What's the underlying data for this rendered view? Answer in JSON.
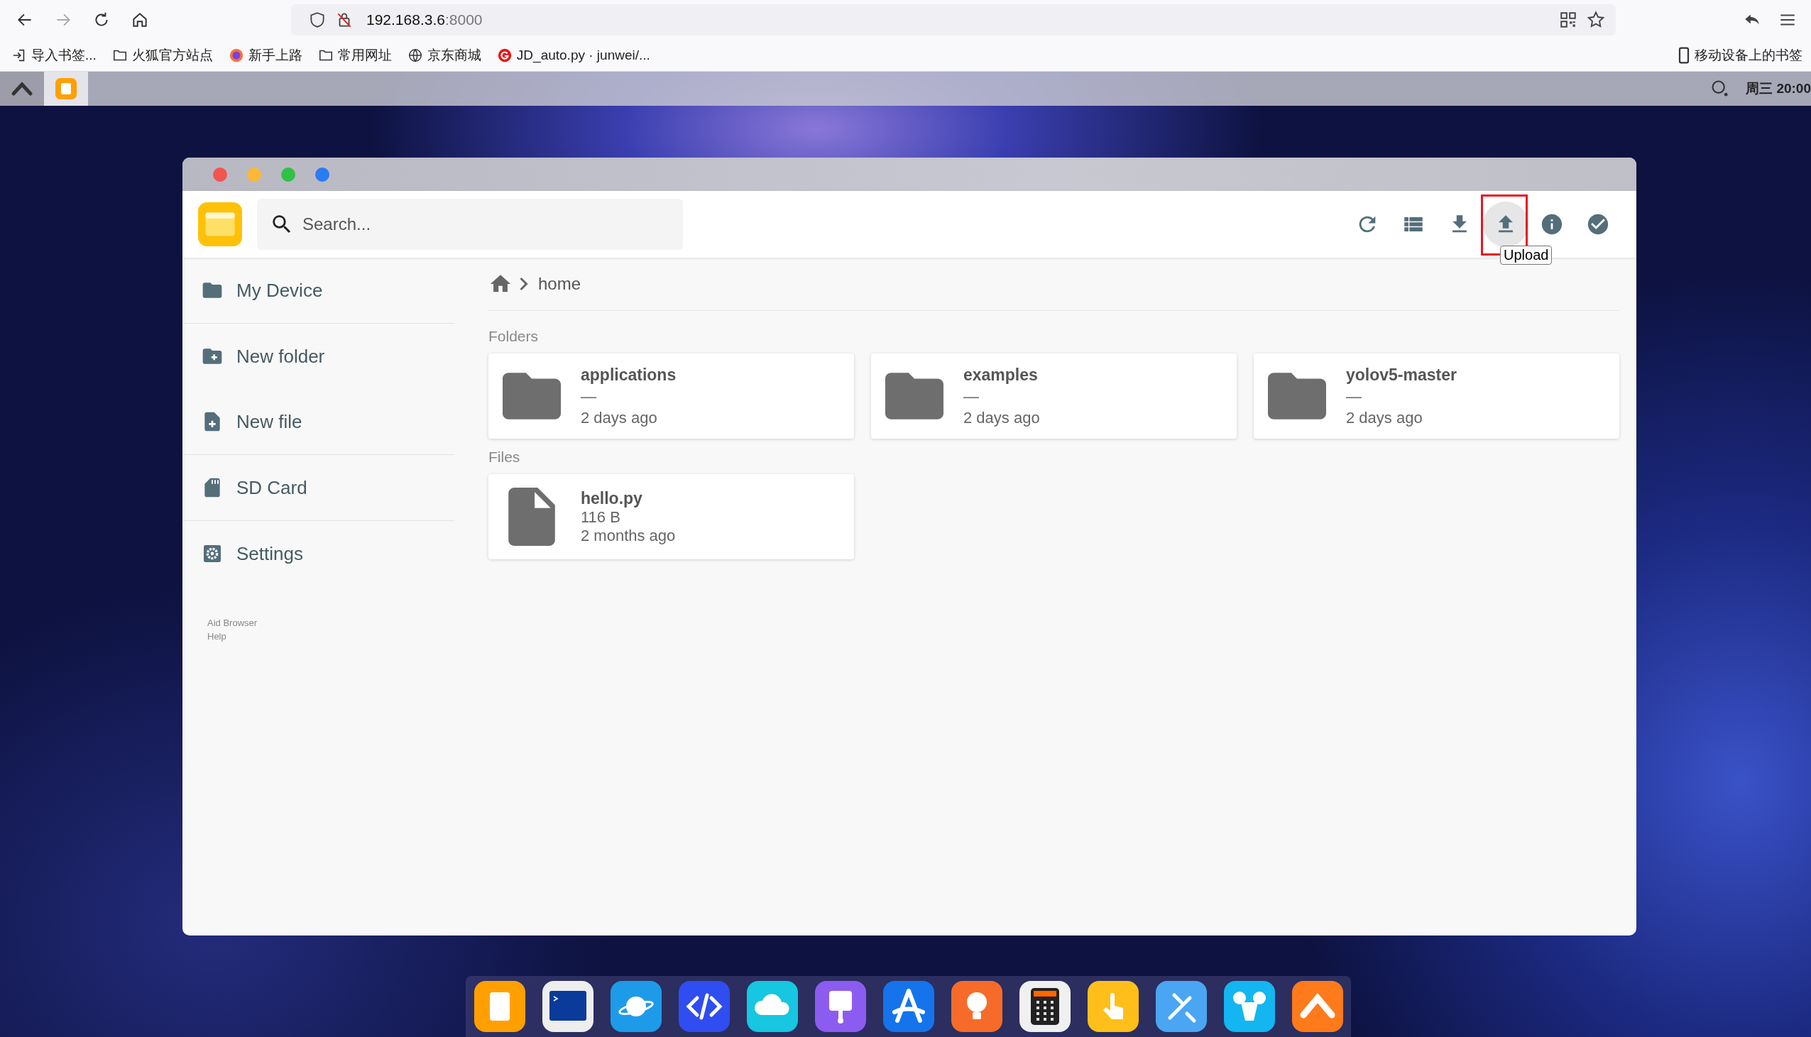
{
  "browser": {
    "url": {
      "host": "192.168.3.6",
      "port": ":8000"
    },
    "bookmarks": [
      {
        "kind": "import",
        "label": "导入书签..."
      },
      {
        "kind": "folder",
        "label": "火狐官方站点"
      },
      {
        "kind": "firefox",
        "label": "新手上路"
      },
      {
        "kind": "folder",
        "label": "常用网址"
      },
      {
        "kind": "globe",
        "label": "京东商城"
      },
      {
        "kind": "g-logo",
        "label": "JD_auto.py · junwei/..."
      }
    ],
    "mobile_bookmarks": "移动设备上的书签"
  },
  "desktop_bar": {
    "clock": "周三 20:00"
  },
  "window": {
    "search": {
      "placeholder": "Search..."
    },
    "toolbar": [
      {
        "kind": "refresh",
        "hovered": false,
        "highlighted": false
      },
      {
        "kind": "list",
        "hovered": false,
        "highlighted": false
      },
      {
        "kind": "download",
        "hovered": false,
        "highlighted": false
      },
      {
        "kind": "upload",
        "hovered": true,
        "highlighted": true,
        "tooltip": "Upload"
      },
      {
        "kind": "info",
        "hovered": false,
        "highlighted": false
      },
      {
        "kind": "check",
        "hovered": false,
        "highlighted": false
      }
    ],
    "sidebar": {
      "items": [
        {
          "kind": "device",
          "label": "My Device",
          "divider": true
        },
        {
          "kind": "new-folder",
          "label": "New folder",
          "divider": false
        },
        {
          "kind": "new-file",
          "label": "New file",
          "divider": true
        },
        {
          "kind": "sd-card",
          "label": "SD Card",
          "divider": true
        },
        {
          "kind": "settings",
          "label": "Settings",
          "divider": false
        }
      ],
      "footer": [
        "Aid Browser",
        "Help"
      ]
    },
    "breadcrumb": [
      "home"
    ],
    "folders_heading": "Folders",
    "folders": [
      {
        "name": "applications",
        "size": "—",
        "modified": "2 days ago"
      },
      {
        "name": "examples",
        "size": "—",
        "modified": "2 days ago"
      },
      {
        "name": "yolov5-master",
        "size": "—",
        "modified": "2 days ago"
      }
    ],
    "files_heading": "Files",
    "files": [
      {
        "name": "hello.py",
        "size": "116 B",
        "modified": "2 months ago"
      }
    ]
  },
  "dock": [
    {
      "kind": "files",
      "color": "#ffa000"
    },
    {
      "kind": "terminal",
      "color": "#eeeeee"
    },
    {
      "kind": "planet",
      "color": "#1e9be8"
    },
    {
      "kind": "code",
      "color": "#2f4df0"
    },
    {
      "kind": "cloud",
      "color": "#17c6e0"
    },
    {
      "kind": "brush",
      "color": "#8c5cf0"
    },
    {
      "kind": "store",
      "color": "#1574ec"
    },
    {
      "kind": "bulb",
      "color": "#f76b2a"
    },
    {
      "kind": "calculator",
      "color": "#f0f0f0"
    },
    {
      "kind": "touch",
      "color": "#ffbf1a"
    },
    {
      "kind": "tools",
      "color": "#4aa6f2"
    },
    {
      "kind": "mouse",
      "color": "#13b6f0"
    },
    {
      "kind": "logo",
      "color": "#ff7a1a"
    }
  ]
}
